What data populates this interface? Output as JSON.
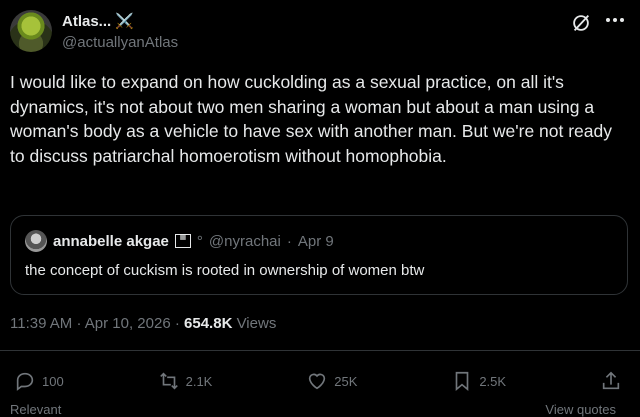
{
  "post": {
    "author": {
      "display_name": "Atlas...",
      "emoji": "⚔️",
      "handle": "@actuallyanAtlas"
    },
    "text": "I would like to expand on how cuckolding as a sexual practice, on all it's dynamics, it's not about two men sharing a woman but about a man using a woman's body as a vehicle to have sex with another man. But we're not ready to discuss patriarchal homoerotism without homophobia.",
    "quoted": {
      "display_name": "annabelle akgae",
      "badge": "°",
      "handle": "@nyrachai",
      "separator": "·",
      "date": "Apr 9",
      "text": "the concept of cuckism is rooted in ownership of women btw"
    },
    "meta": {
      "time": "11:39 AM",
      "separator": "·",
      "date": "Apr 10, 2026",
      "separator2": "·",
      "views_count": "654.8K",
      "views_label": "Views"
    },
    "actions": {
      "replies": "100",
      "reposts": "2.1K",
      "likes": "25K",
      "bookmarks": "2.5K"
    },
    "footer": {
      "left": "Relevant",
      "right": "View quotes"
    }
  },
  "icons": [
    "grok-icon",
    "more-icon",
    "reply-icon",
    "repost-icon",
    "like-icon",
    "bookmark-icon",
    "share-icon"
  ],
  "colors": {
    "background": "#000000",
    "text": "#e7e9ea",
    "muted": "#71767b",
    "border": "#2f3336"
  }
}
